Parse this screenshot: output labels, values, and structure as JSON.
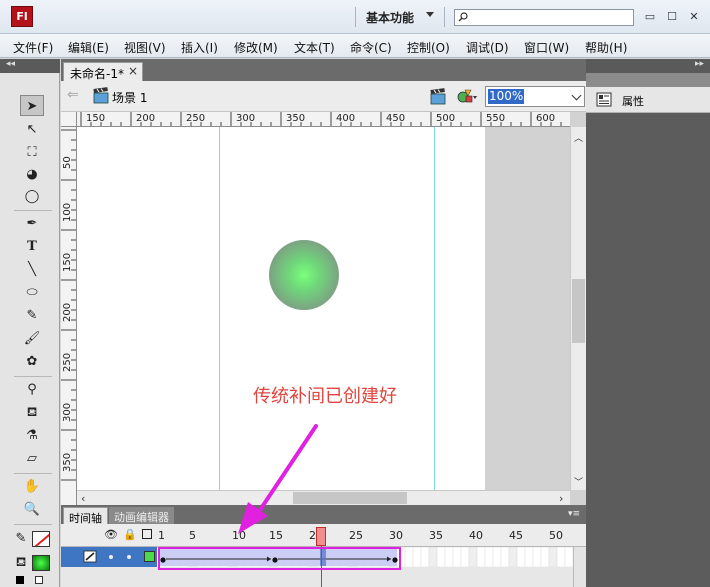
{
  "app": {
    "logo_text": "Fl",
    "workspace": "基本功能",
    "search_placeholder": "",
    "window_controls": [
      "▭",
      "☐",
      "✕"
    ]
  },
  "menu": [
    "文件(F)",
    "编辑(E)",
    "视图(V)",
    "插入(I)",
    "修改(M)",
    "文本(T)",
    "命令(C)",
    "控制(O)",
    "调试(D)",
    "窗口(W)",
    "帮助(H)"
  ],
  "document": {
    "tab_label": "未命名-1*",
    "tab_close": "×",
    "scene_label": "场景 1",
    "zoom": "100%"
  },
  "rulers": {
    "horizontal": [
      "150",
      "200",
      "250",
      "300",
      "350",
      "400",
      "450",
      "500",
      "550",
      "600"
    ],
    "vertical": [
      "50",
      "100",
      "150",
      "200",
      "250",
      "300",
      "350"
    ]
  },
  "stage": {
    "annotation": "传统补间已创建好",
    "ball_color": "#7bff7b"
  },
  "timeline": {
    "tabs": [
      "时间轴",
      "动画编辑器"
    ],
    "frame_numbers": [
      "1",
      "5",
      "10",
      "15",
      "20",
      "25",
      "30",
      "35",
      "40",
      "45",
      "50"
    ],
    "current_frame": 21,
    "tween_start_frame": 1,
    "tween_end_frame": 30,
    "keyframes": [
      1,
      15,
      30
    ],
    "layer_color": "#4cd94c"
  },
  "properties_panel": {
    "label": "属性"
  },
  "colors": {
    "highlight_magenta": "#e021e0",
    "annotation_red": "#e0443c",
    "selection_blue": "#3169c6"
  }
}
